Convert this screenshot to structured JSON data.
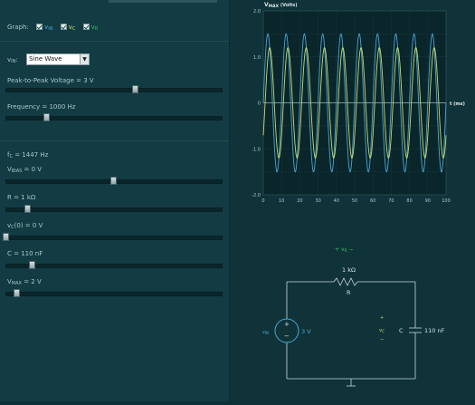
{
  "controls": {
    "graph_label": "Graph:",
    "graph_options": [
      {
        "main": "v",
        "sub": "IN",
        "color": "#4aa6d3"
      },
      {
        "main": "v",
        "sub": "C",
        "color": "#c8dd6a"
      },
      {
        "main": "v",
        "sub": "R",
        "color": "#3fbf62"
      }
    ],
    "vin_main": "v",
    "vin_sub": "IN",
    "vin_colon": ":",
    "waveform": "Sine Wave",
    "vpp": {
      "label": "Peak-to-Peak Voltage = 3 V",
      "fraction": 0.6
    },
    "freq": {
      "label": "Frequency = 1000 Hz",
      "fraction": 0.19
    },
    "fc": {
      "main": "f",
      "sub": "C",
      "rest": " = 1447 Hz"
    },
    "vbias": {
      "main": "V",
      "sub": "BIAS",
      "rest": " = 0 V",
      "fraction": 0.5
    },
    "r": {
      "label": "R = 1 kΩ",
      "fraction": 0.1
    },
    "vc0": {
      "main": "v",
      "sub": "C",
      "rest": "(0) = 0 V",
      "fraction": 0.0
    },
    "c": {
      "label": "C = 110 nF",
      "fraction": 0.12
    },
    "vmax": {
      "main": "V",
      "sub": "MAX",
      "rest": " = 2 V",
      "fraction": 0.05
    }
  },
  "chart": {
    "title_main": "V",
    "title_sub": "MAX",
    "title_rest": " (Volts)",
    "x_axis_label": "t (ms)",
    "x_ticks": [
      "0",
      "10",
      "20",
      "30",
      "40",
      "50",
      "60",
      "70",
      "80",
      "90",
      "100"
    ],
    "y_ticks": [
      "2.0",
      "1.0",
      "0",
      "-1.0",
      "-2.0"
    ]
  },
  "chart_data": {
    "type": "line",
    "title": "VMAX (Volts)",
    "xlabel": "t (ms)",
    "ylabel": "VMAX (Volts)",
    "xlim": [
      0,
      100
    ],
    "ylim": [
      -2,
      2
    ],
    "grid": true,
    "series": [
      {
        "name": "vIN",
        "color": "#4aa6d3",
        "amplitude": 1.5,
        "period_ms": 10,
        "phase_ms": 0
      },
      {
        "name": "vC",
        "color": "#c8dd6a",
        "amplitude": 1.2,
        "period_ms": 10,
        "phase_ms": 1.0
      }
    ]
  },
  "circuit": {
    "vr_label_main": "v",
    "vr_label_sub": "R",
    "r_value": "1 kΩ",
    "r_name": "R",
    "source_main": "v",
    "source_sub": "IN",
    "source_value": "3 V",
    "vc_main": "v",
    "vc_sub": "C",
    "c_name": "C",
    "c_value": "110 nF",
    "plus": "+",
    "minus": "−"
  },
  "colors": {
    "vin": "#4aa6d3",
    "vc": "#c8dd6a",
    "vr": "#3fbf62",
    "wire": "#c9d7d9"
  }
}
